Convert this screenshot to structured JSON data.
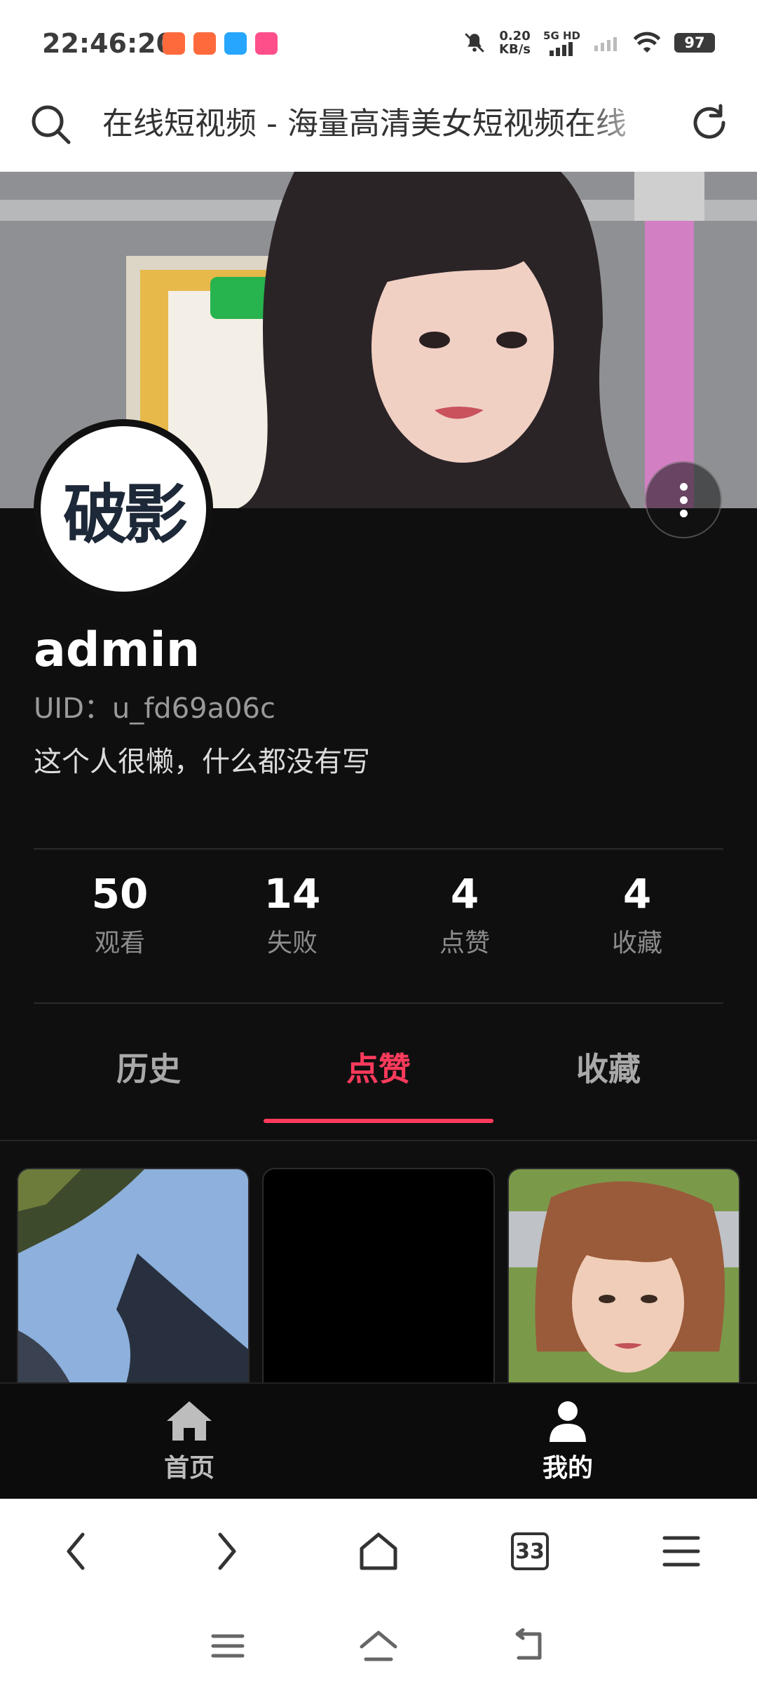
{
  "status_bar": {
    "time": "22:46:20",
    "net_speed_value": "0.20",
    "net_speed_unit": "KB/s",
    "network": "5G HD",
    "battery": "97",
    "app_badges": [
      "#ff6a3d",
      "#ff6a3d",
      "#26a6ff",
      "#ff4f8b"
    ]
  },
  "address_bar": {
    "title": "在线短视频 - 海量高清美女短视频在线"
  },
  "profile": {
    "avatar_text": "破影",
    "username": "admin",
    "uid": "UID：u_fd69a06c",
    "bio": "这个人很懒，什么都没有写"
  },
  "stats": [
    {
      "value": "50",
      "label": "观看"
    },
    {
      "value": "14",
      "label": "失败"
    },
    {
      "value": "4",
      "label": "点赞"
    },
    {
      "value": "4",
      "label": "收藏"
    }
  ],
  "tabs": [
    {
      "label": "历史",
      "active": false
    },
    {
      "label": "点赞",
      "active": true
    },
    {
      "label": "收藏",
      "active": false
    }
  ],
  "app_nav": {
    "home_label": "首页",
    "me_label": "我的"
  },
  "browser_bar": {
    "tab_count": "33"
  },
  "colors": {
    "accent": "#ff3b5c",
    "background": "#0f0f10"
  }
}
